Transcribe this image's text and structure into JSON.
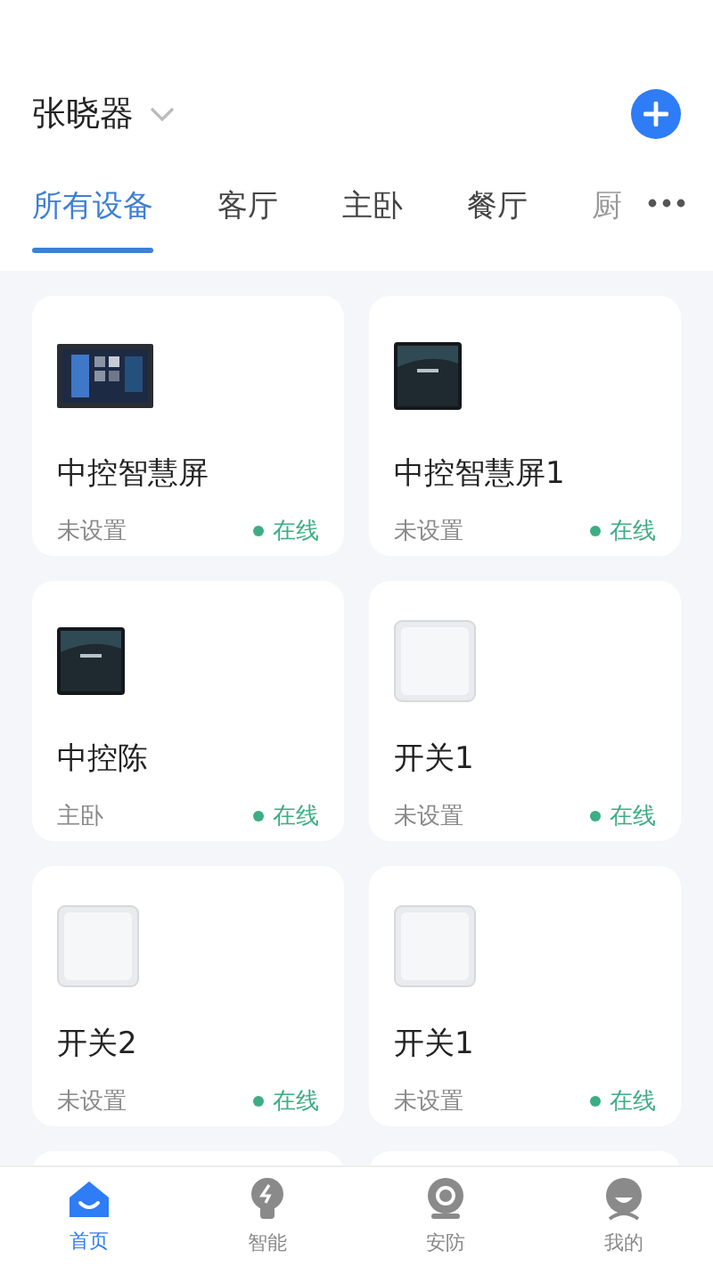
{
  "header": {
    "home_name": "张晓器"
  },
  "tabs": [
    {
      "label": "所有设备",
      "selected": true
    },
    {
      "label": "客厅",
      "selected": false
    },
    {
      "label": "主卧",
      "selected": false
    },
    {
      "label": "餐厅",
      "selected": false
    },
    {
      "label": "厨",
      "selected": false
    }
  ],
  "devices": [
    {
      "kind": "wide_panel",
      "name": "中控智慧屏",
      "room": "未设置",
      "status": "在线",
      "online": true
    },
    {
      "kind": "square_panel",
      "name": "中控智慧屏1",
      "room": "未设置",
      "status": "在线",
      "online": true
    },
    {
      "kind": "square_panel",
      "name": "中控陈",
      "room": "主卧",
      "status": "在线",
      "online": true
    },
    {
      "kind": "switch",
      "name": "开关1",
      "room": "未设置",
      "status": "在线",
      "online": true
    },
    {
      "kind": "switch",
      "name": "开关2",
      "room": "未设置",
      "status": "在线",
      "online": true
    },
    {
      "kind": "switch",
      "name": "开关1",
      "room": "未设置",
      "status": "在线",
      "online": true
    }
  ],
  "bottom_nav": [
    {
      "kind": "home",
      "label": "首页",
      "selected": true
    },
    {
      "kind": "smart",
      "label": "智能",
      "selected": false
    },
    {
      "kind": "security",
      "label": "安防",
      "selected": false
    },
    {
      "kind": "profile",
      "label": "我的",
      "selected": false
    }
  ]
}
